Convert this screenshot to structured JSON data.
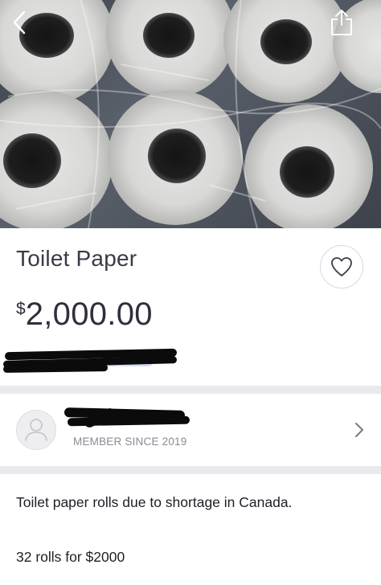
{
  "listing": {
    "title": "Toilet Paper",
    "price_currency": "$",
    "price_amount": "2,000.00"
  },
  "seller": {
    "member_since": "MEMBER SINCE 2019"
  },
  "description": {
    "line1": "Toilet paper rolls due to shortage in Canada.",
    "line2": "32 rolls for $2000"
  },
  "icons": {
    "back": "chevron-left-icon",
    "share": "share-icon",
    "favorite": "heart-icon",
    "avatar": "user-icon",
    "seller_link": "chevron-right-icon"
  }
}
